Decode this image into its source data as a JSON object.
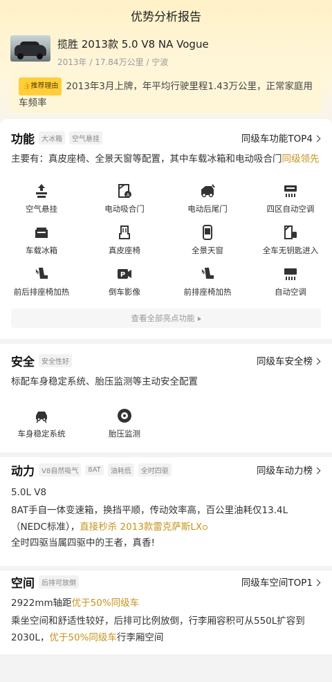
{
  "page": {
    "title": "优势分析报告"
  },
  "car": {
    "name": "揽胜 2013款 5.0 V8 NA Vogue",
    "meta": "2013年 / 17.84万公里 / 宁波"
  },
  "reason": {
    "tag": "推荐理由",
    "text": "2013年3月上牌，年平均行驶里程1.43万公里，正常家庭用车频率"
  },
  "features": {
    "title": "功能",
    "chips": [
      "大冰箱",
      "空气悬挂"
    ],
    "link": "同级车功能TOP4",
    "desc_pre": "主要有：真皮座椅、全景天窗等配置，其中车载冰箱和电动吸合门",
    "desc_highlight": "同级领先",
    "items": [
      {
        "label": "空气悬挂",
        "icon": "air-suspension-icon"
      },
      {
        "label": "电动吸合门",
        "icon": "soft-close-door-icon"
      },
      {
        "label": "电动后尾门",
        "icon": "power-tailgate-icon"
      },
      {
        "label": "四区自动空调",
        "icon": "four-zone-ac-icon"
      },
      {
        "label": "车载冰箱",
        "icon": "car-fridge-icon"
      },
      {
        "label": "真皮座椅",
        "icon": "leather-seat-icon"
      },
      {
        "label": "全景天窗",
        "icon": "panoramic-sunroof-icon"
      },
      {
        "label": "全车无钥匙进入",
        "icon": "keyless-entry-icon"
      },
      {
        "label": "前后排座椅加热",
        "icon": "seat-heating-icon"
      },
      {
        "label": "倒车影像",
        "icon": "parking-camera-icon"
      },
      {
        "label": "前排座椅加热",
        "icon": "front-seat-heating-icon"
      },
      {
        "label": "自动空调",
        "icon": "auto-ac-icon"
      }
    ],
    "more": "查看全部亮点功能"
  },
  "safety": {
    "title": "安全",
    "chips": [
      "安全性好"
    ],
    "link": "同级车安全榜",
    "desc": "标配车身稳定系统、胎压监测等主动安全配置",
    "items": [
      {
        "label": "车身稳定系统",
        "icon": "stability-control-icon"
      },
      {
        "label": "胎压监测",
        "icon": "tire-pressure-icon"
      }
    ]
  },
  "power": {
    "title": "动力",
    "chips": [
      "V8自然吸气",
      "8AT",
      "油耗低",
      "全时四驱"
    ],
    "link": "同级车动力榜",
    "engine": "5.0L V8",
    "desc_pre": "8AT手自一体变速箱，换挡平顺，传动效率高，百公里油耗仅13.4L（NEDC标准），",
    "desc_highlight": "直接秒杀 2013款雷克萨斯LX",
    "desc2": "全时四驱当属四驱中的王者，真香!"
  },
  "space": {
    "title": "空间",
    "chips": [
      "后排可放倒"
    ],
    "link": "同级车空间TOP1",
    "line1_pre": "2922mm轴距",
    "line1_highlight": "优于50%同级车",
    "line2_pre": "乘坐空间和舒适性较好，后排可比例放倒，行李厢容积可从550L扩容到2030L，",
    "line2_highlight": "优于50%同级车",
    "line2_post": "行李厢空间"
  },
  "colors": {
    "accent": "#c7931c",
    "tag_bg": "#ffcf3a",
    "header_bg": "#fff2c8"
  }
}
